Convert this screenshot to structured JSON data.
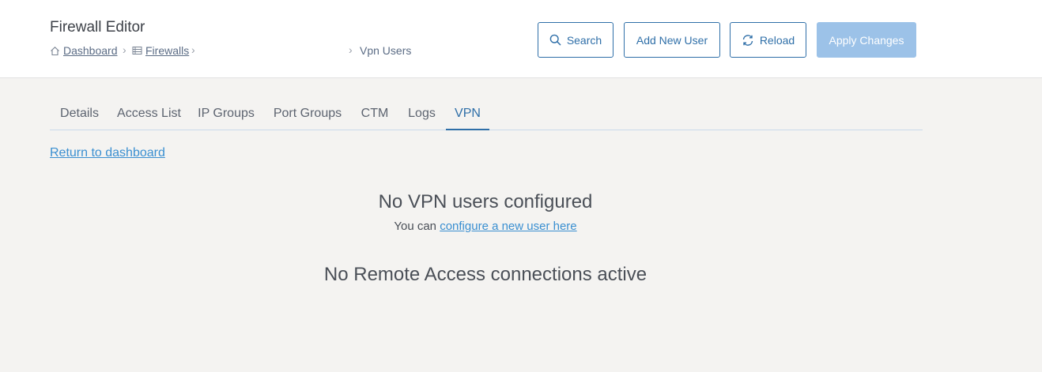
{
  "header": {
    "title": "Firewall Editor",
    "breadcrumb": {
      "dashboard": "Dashboard",
      "firewalls": "Firewalls",
      "current": "Vpn Users"
    }
  },
  "toolbar": {
    "search_label": "Search",
    "add_user_label": "Add New User",
    "reload_label": "Reload",
    "apply_label": "Apply Changes"
  },
  "tabs": [
    {
      "label": "Details"
    },
    {
      "label": "Access List"
    },
    {
      "label": "IP Groups"
    },
    {
      "label": "Port Groups"
    },
    {
      "label": "CTM"
    },
    {
      "label": "Logs"
    },
    {
      "label": "VPN",
      "active": true
    }
  ],
  "content": {
    "return_link": "Return to dashboard",
    "vpn_empty_title": "No VPN users configured",
    "vpn_empty_prefix": "You can",
    "vpn_empty_link": "configure a new user here",
    "remote_access_title": "No Remote Access connections active"
  },
  "colors": {
    "accent": "#2f6fa8",
    "link": "#3a8fd1",
    "apply_disabled": "#9cc2e8",
    "background": "#f4f3f1"
  },
  "icons": {
    "dashboard": "home-icon",
    "firewalls": "list-icon",
    "search": "search-icon",
    "reload": "reload-icon"
  }
}
